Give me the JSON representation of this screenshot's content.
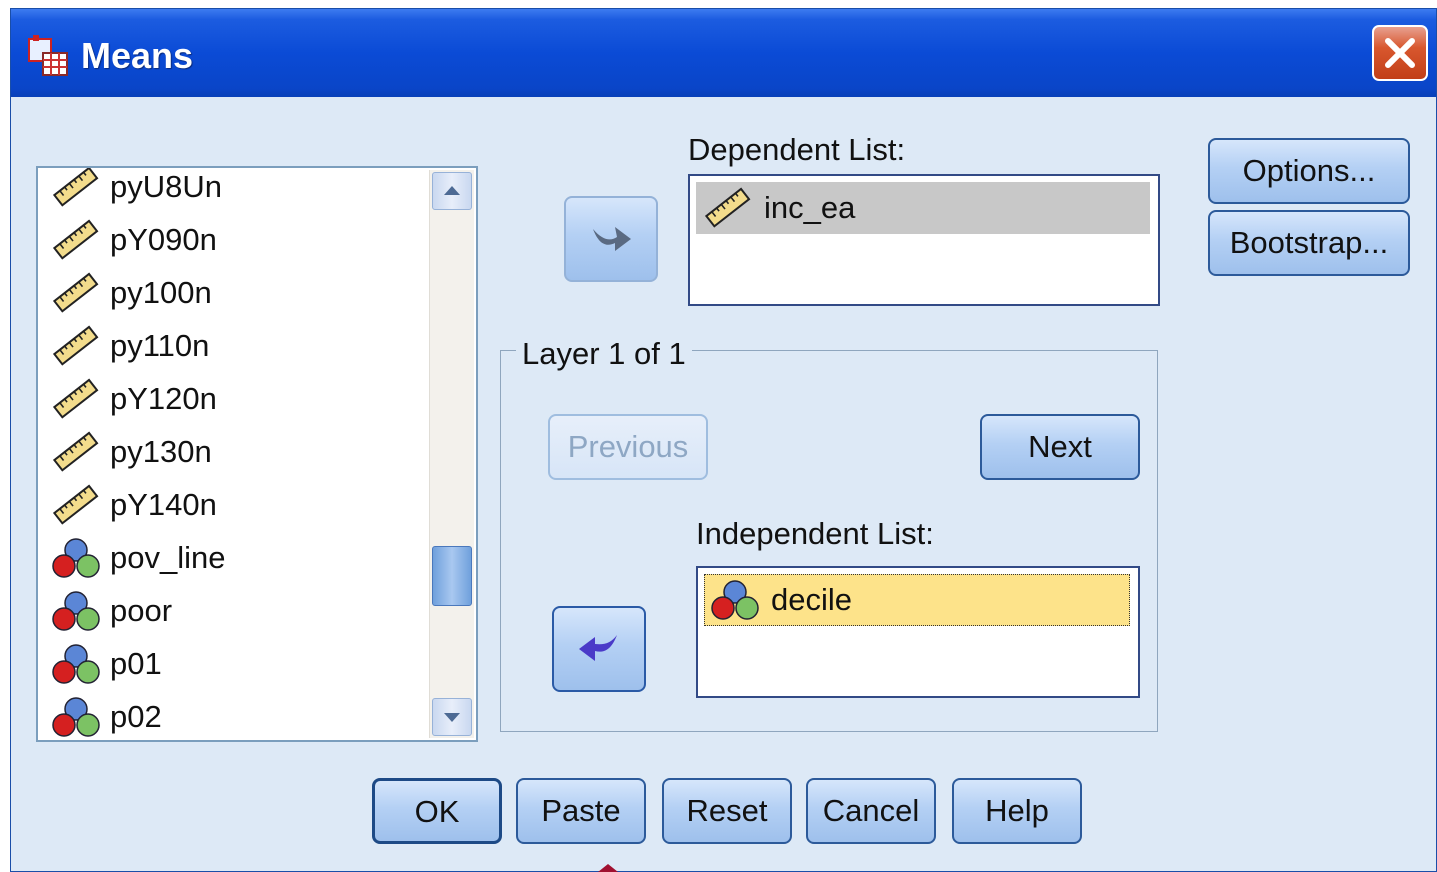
{
  "window": {
    "title": "Means",
    "app_icon": "spss-means-icon",
    "close_icon": "close-icon"
  },
  "variables": [
    {
      "name": "pyU8Un",
      "icon": "scale-ruler-icon"
    },
    {
      "name": "pY090n",
      "icon": "scale-ruler-icon"
    },
    {
      "name": "py100n",
      "icon": "scale-ruler-icon"
    },
    {
      "name": "py110n",
      "icon": "scale-ruler-icon"
    },
    {
      "name": "pY120n",
      "icon": "scale-ruler-icon"
    },
    {
      "name": "py130n",
      "icon": "scale-ruler-icon"
    },
    {
      "name": "pY140n",
      "icon": "scale-ruler-icon"
    },
    {
      "name": "pov_line",
      "icon": "nominal-balls-icon"
    },
    {
      "name": "poor",
      "icon": "nominal-balls-icon"
    },
    {
      "name": "p01",
      "icon": "nominal-balls-icon"
    },
    {
      "name": "p02",
      "icon": "nominal-balls-icon"
    }
  ],
  "dependent": {
    "label": "Dependent List:",
    "items": [
      "inc_ea"
    ]
  },
  "layer": {
    "title": "Layer 1 of 1",
    "previous": "Previous",
    "next": "Next"
  },
  "independent": {
    "label": "Independent List:",
    "items": [
      "decile"
    ]
  },
  "side_buttons": {
    "options": "Options...",
    "bootstrap": "Bootstrap..."
  },
  "bottom_buttons": {
    "ok": "OK",
    "paste": "Paste",
    "reset": "Reset",
    "cancel": "Cancel",
    "help": "Help"
  },
  "colors": {
    "titlebar": "#0b4bd6",
    "dialog_bg": "#dde9f6",
    "dependent_selection": "#c8c8c8",
    "independent_selection": "#fde38a"
  }
}
